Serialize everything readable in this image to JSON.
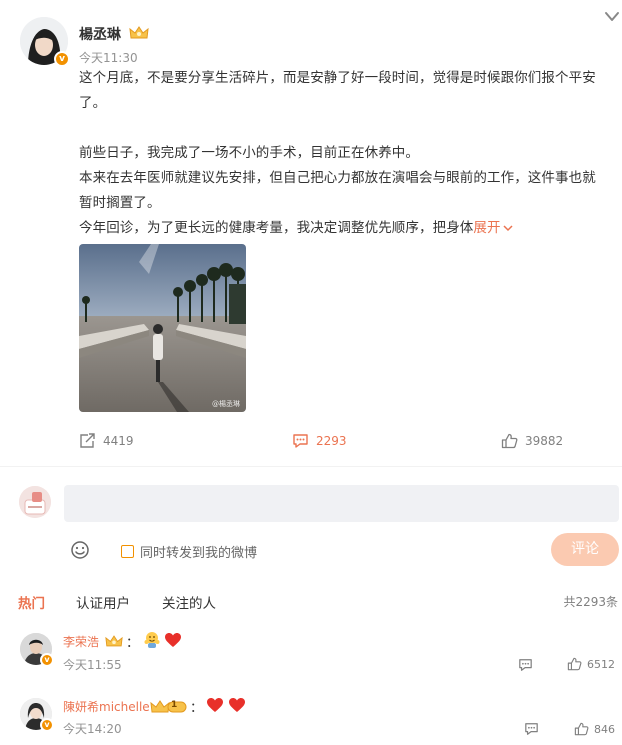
{
  "post": {
    "author": "楊丞琳",
    "time": "今天11:30",
    "paragraphs": [
      "这个月底，不是要分享生活碎片，而是安静了好一段时间，觉得是时候跟你们报个平安了。",
      "",
      "前些日子，我完成了一场不小的手术，目前正在休养中。",
      "本来在去年医师就建议先安排，但自己把心力都放在演唱会与眼前的工作，这件事也就暂时搁置了。"
    ],
    "last_line": "今年回诊，为了更长远的健康考量，我决定调整优先顺序，把身体",
    "expand_label": "展开",
    "image_watermark": "@楊丞琳",
    "stats": {
      "reposts": "4419",
      "comments": "2293",
      "likes": "39882"
    }
  },
  "composer": {
    "input_value": "",
    "repost_label": "同时转发到我的微博",
    "submit_label": "评论"
  },
  "tabs": [
    "热门",
    "认证用户",
    "关注的人"
  ],
  "total_comments": "共2293条",
  "comments": [
    {
      "name": "李荣浩",
      "time": "今天11:55",
      "likes": "6512"
    },
    {
      "name": "陳妍希michelle",
      "time": "今天14:20",
      "likes": "846",
      "level": "1"
    }
  ],
  "colors": {
    "accent": "#eb7350",
    "verified_badge": "#f29100",
    "submit_disabled": "#fbcab1"
  },
  "icons": [
    "chevron-down-icon",
    "crown-icon",
    "repost-icon",
    "comment-icon",
    "like-icon",
    "emoji-icon",
    "heart-icon",
    "hugging-emoji"
  ]
}
